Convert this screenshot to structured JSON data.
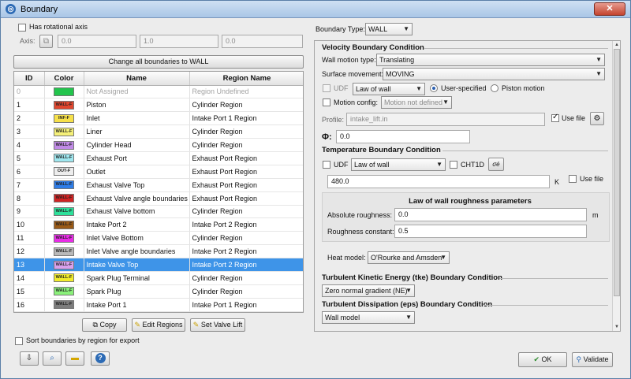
{
  "window": {
    "title": "Boundary",
    "close_icon": "close-icon"
  },
  "left": {
    "rotational_axis_label": "Has rotational axis",
    "rotational_axis_checked": false,
    "axis_label": "Axis:",
    "axis_values": [
      "0.0",
      "1.0",
      "0.0"
    ],
    "change_all_button": "Change all boundaries to WALL",
    "table": {
      "columns": [
        "ID",
        "Color",
        "Name",
        "Region Name"
      ],
      "rows": [
        {
          "id": "0",
          "color": "#22c44c",
          "tag": "",
          "name": "Not Assigned",
          "region": "Region Undefined",
          "dim": true
        },
        {
          "id": "1",
          "color": "#e0462e",
          "tag": "WALL-F",
          "name": "Piston",
          "region": "Cylinder Region"
        },
        {
          "id": "2",
          "color": "#f6e04a",
          "tag": "INF-F",
          "name": "Inlet",
          "region": "Intake Port 1 Region"
        },
        {
          "id": "3",
          "color": "#f5f078",
          "tag": "WALL-F",
          "name": "Liner",
          "region": "Cylinder Region"
        },
        {
          "id": "4",
          "color": "#c08ae6",
          "tag": "WALL-F",
          "name": "Cylinder Head",
          "region": "Cylinder Region"
        },
        {
          "id": "5",
          "color": "#9fe7ef",
          "tag": "WALL-F",
          "name": "Exhaust Port",
          "region": "Exhaust Port Region"
        },
        {
          "id": "6",
          "color": "#ededed",
          "tag": "OUT-F",
          "name": "Outlet",
          "region": "Exhaust Port Region"
        },
        {
          "id": "7",
          "color": "#2f7de8",
          "tag": "WALL-F",
          "name": "Exhaust Valve Top",
          "region": "Exhaust Port Region"
        },
        {
          "id": "8",
          "color": "#cf2323",
          "tag": "WALL-F",
          "name": "Exhaust Valve angle boundaries",
          "region": "Exhaust Port Region"
        },
        {
          "id": "9",
          "color": "#2de09a",
          "tag": "WALL-F",
          "name": "Exhaust Valve bottom",
          "region": "Cylinder Region"
        },
        {
          "id": "10",
          "color": "#9a5a16",
          "tag": "WALL-F",
          "name": "Intake Port 2",
          "region": "Intake Port 2 Region"
        },
        {
          "id": "11",
          "color": "#e82de6",
          "tag": "WALL-F",
          "name": "Inlet Valve Bottom",
          "region": "Cylinder Region"
        },
        {
          "id": "12",
          "color": "#b9b9b9",
          "tag": "WALL-F",
          "name": "Inlet Valve angle boundaries",
          "region": "Intake Port 2 Region"
        },
        {
          "id": "13",
          "color": "#d9a0ec",
          "tag": "WALL-F",
          "name": "Intake Valve Top",
          "region": "Intake Port 2 Region",
          "selected": true
        },
        {
          "id": "14",
          "color": "#f1ec2c",
          "tag": "WALL-F",
          "name": "Spark Plug Terminal",
          "region": "Cylinder Region"
        },
        {
          "id": "15",
          "color": "#8af07a",
          "tag": "WALL-F",
          "name": "Spark Plug",
          "region": "Cylinder Region"
        },
        {
          "id": "16",
          "color": "#7d7d7d",
          "tag": "WALL-F",
          "name": "Intake Port 1",
          "region": "Intake Port 1 Region"
        }
      ]
    },
    "copy_button": "Copy",
    "edit_regions_button": "Edit Regions",
    "set_valve_lift_button": "Set Valve Lift",
    "sort_label": "Sort boundaries by region for export"
  },
  "right": {
    "boundary_type_label": "Boundary Type:",
    "boundary_type_value": "WALL",
    "velocity": {
      "title": "Velocity Boundary Condition",
      "wall_motion_label": "Wall motion type:",
      "wall_motion_value": "Translating",
      "surface_movement_label": "Surface movement:",
      "surface_movement_value": "MOVING",
      "udf_label": "UDF",
      "law_value": "Law of wall",
      "user_specified_label": "User-specified",
      "piston_motion_label": "Piston motion",
      "motion_config_label": "Motion config:",
      "motion_config_value": "Motion not defined",
      "profile_label": "Profile:",
      "profile_value": "intake_lift.in",
      "use_file_label": "Use file",
      "use_file_checked": true,
      "phi_label": "Φ:",
      "phi_value": "0.0"
    },
    "temperature": {
      "title": "Temperature Boundary Condition",
      "udf_label": "UDF",
      "law_value": "Law of wall",
      "cht1d_label": "CHT1D",
      "value": "480.0",
      "unit": "K",
      "use_file_label": "Use file"
    },
    "roughness": {
      "title": "Law of wall roughness parameters",
      "absolute_label": "Absolute roughness:",
      "absolute_value": "0.0",
      "absolute_unit": "m",
      "constant_label": "Roughness constant:",
      "constant_value": "0.5"
    },
    "heat_model_label": "Heat model:",
    "heat_model_value": "O'Rourke and Amsden",
    "tke": {
      "title": "Turbulent Kinetic Energy (tke) Boundary Condition",
      "value": "Zero normal gradient (NE)"
    },
    "eps": {
      "title": "Turbulent Dissipation (eps) Boundary Condition",
      "value": "Wall model"
    }
  },
  "footer": {
    "ok_label": "OK",
    "validate_label": "Validate"
  }
}
